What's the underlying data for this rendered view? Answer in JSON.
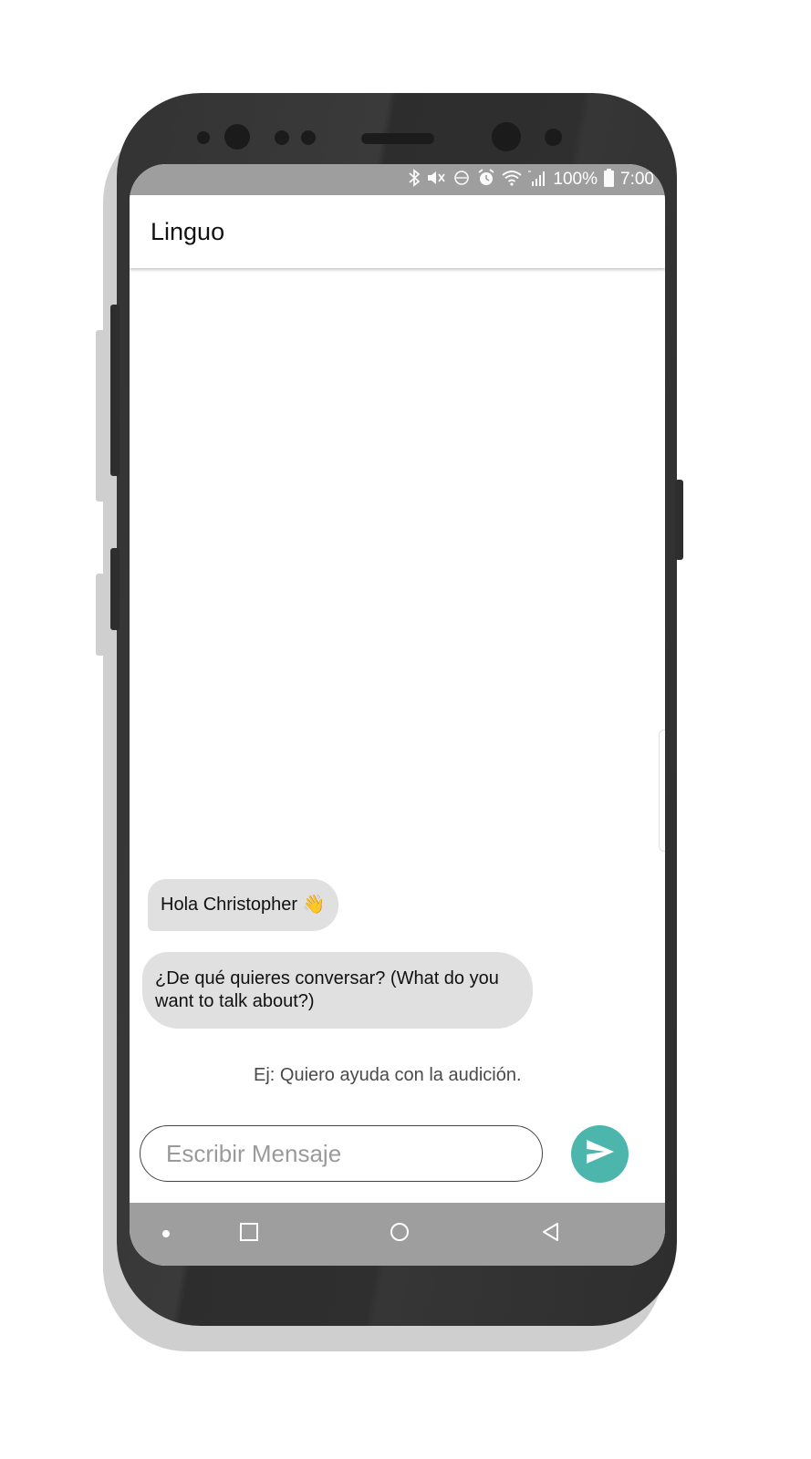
{
  "status_bar": {
    "icons": [
      "bluetooth-icon",
      "vibrate-mute-icon",
      "volte-icon",
      "alarm-icon",
      "wifi-icon",
      "lte-signal-icon",
      "battery-icon"
    ],
    "battery": "100%",
    "time": "7:00"
  },
  "app_bar": {
    "title": "Linguo"
  },
  "chat": {
    "messages": [
      {
        "sender": "bot",
        "text": "Hola Christopher 👋"
      },
      {
        "sender": "bot",
        "text": "¿De qué quieres conversar? (What do you want to talk about?)"
      }
    ],
    "hint": "Ej: Quiero ayuda con la audición."
  },
  "composer": {
    "placeholder": "Escribir Mensaje",
    "value": "",
    "send_icon": "send-icon",
    "send_color": "#4db6ac"
  },
  "nav_bar": {
    "items": [
      "dot-icon",
      "recents-icon",
      "home-icon",
      "back-icon"
    ]
  }
}
